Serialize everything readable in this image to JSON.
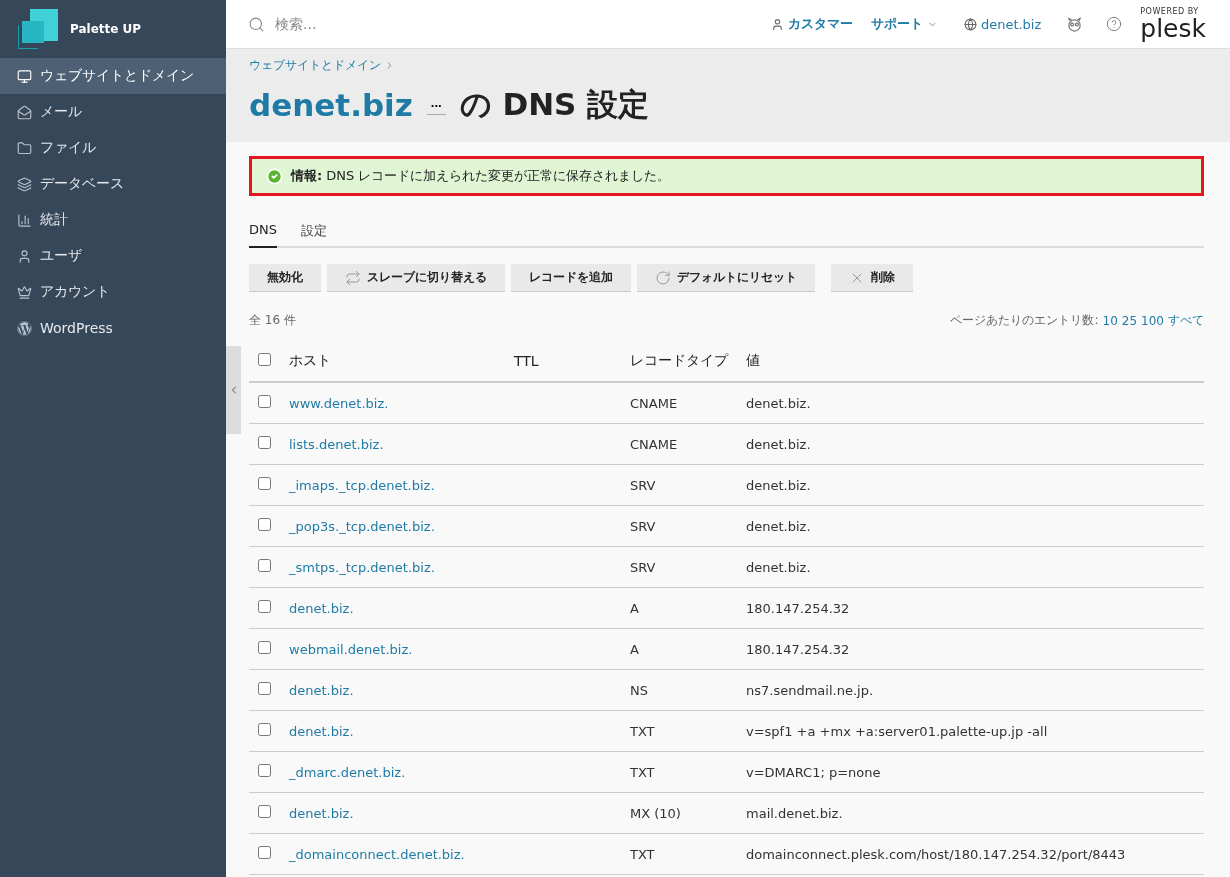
{
  "brand": {
    "name": "Palette UP"
  },
  "sidebar": {
    "items": [
      {
        "label": "ウェブサイトとドメイン",
        "selected": true
      },
      {
        "label": "メール",
        "selected": false
      },
      {
        "label": "ファイル",
        "selected": false
      },
      {
        "label": "データベース",
        "selected": false
      },
      {
        "label": "統計",
        "selected": false
      },
      {
        "label": "ユーザ",
        "selected": false
      },
      {
        "label": "アカウント",
        "selected": false
      },
      {
        "label": "WordPress",
        "selected": false
      }
    ]
  },
  "topbar": {
    "search": {
      "placeholder": "検索..."
    },
    "customer": "カスタマー",
    "support": "サポート",
    "domain": "denet.biz",
    "powered_by": "POWERED BY",
    "logo": "plesk"
  },
  "breadcrumb": [
    "ウェブサイトとドメイン"
  ],
  "title": {
    "domain": "denet.biz",
    "more": "...",
    "rest": "の DNS 設定"
  },
  "notice": {
    "label": "情報:",
    "text": "DNS レコードに加えられた変更が正常に保存されました。"
  },
  "tabs": [
    {
      "label": "DNS",
      "selected": true
    },
    {
      "label": "設定",
      "selected": false
    }
  ],
  "toolbar": [
    "無効化",
    "スレーブに切り替える",
    "レコードを追加",
    "デフォルトにリセット",
    "削除"
  ],
  "total": "全 16 件",
  "per_page": {
    "label": "ページあたりのエントリ数:",
    "options": [
      "10",
      "25",
      "100",
      "すべて"
    ]
  },
  "table": {
    "all_checked": false,
    "columns": [
      "ホスト",
      "TTL",
      "レコードタイプ",
      "値"
    ],
    "rows": [
      {
        "host": "www.denet.biz.",
        "ttl": "",
        "type": "CNAME",
        "value": "denet.biz.",
        "checked": false
      },
      {
        "host": "lists.denet.biz.",
        "ttl": "",
        "type": "CNAME",
        "value": "denet.biz.",
        "checked": false
      },
      {
        "host": "_imaps._tcp.denet.biz.",
        "ttl": "",
        "type": "SRV",
        "value": "denet.biz.",
        "checked": false
      },
      {
        "host": "_pop3s._tcp.denet.biz.",
        "ttl": "",
        "type": "SRV",
        "value": "denet.biz.",
        "checked": false
      },
      {
        "host": "_smtps._tcp.denet.biz.",
        "ttl": "",
        "type": "SRV",
        "value": "denet.biz.",
        "checked": false
      },
      {
        "host": "denet.biz.",
        "ttl": "",
        "type": "A",
        "value": "180.147.254.32",
        "checked": false
      },
      {
        "host": "webmail.denet.biz.",
        "ttl": "",
        "type": "A",
        "value": "180.147.254.32",
        "checked": false
      },
      {
        "host": "denet.biz.",
        "ttl": "",
        "type": "NS",
        "value": "ns7.sendmail.ne.jp.",
        "checked": false
      },
      {
        "host": "denet.biz.",
        "ttl": "",
        "type": "TXT",
        "value": "v=spf1 +a +mx +a:server01.palette-up.jp -all",
        "checked": false
      },
      {
        "host": "_dmarc.denet.biz.",
        "ttl": "",
        "type": "TXT",
        "value": "v=DMARC1; p=none",
        "checked": false
      },
      {
        "host": "denet.biz.",
        "ttl": "",
        "type": "MX (10)",
        "value": "mail.denet.biz.",
        "checked": false
      },
      {
        "host": "_domainconnect.denet.biz.",
        "ttl": "",
        "type": "TXT",
        "value": "domainconnect.plesk.com/host/180.147.254.32/port/8443",
        "checked": false
      }
    ]
  }
}
